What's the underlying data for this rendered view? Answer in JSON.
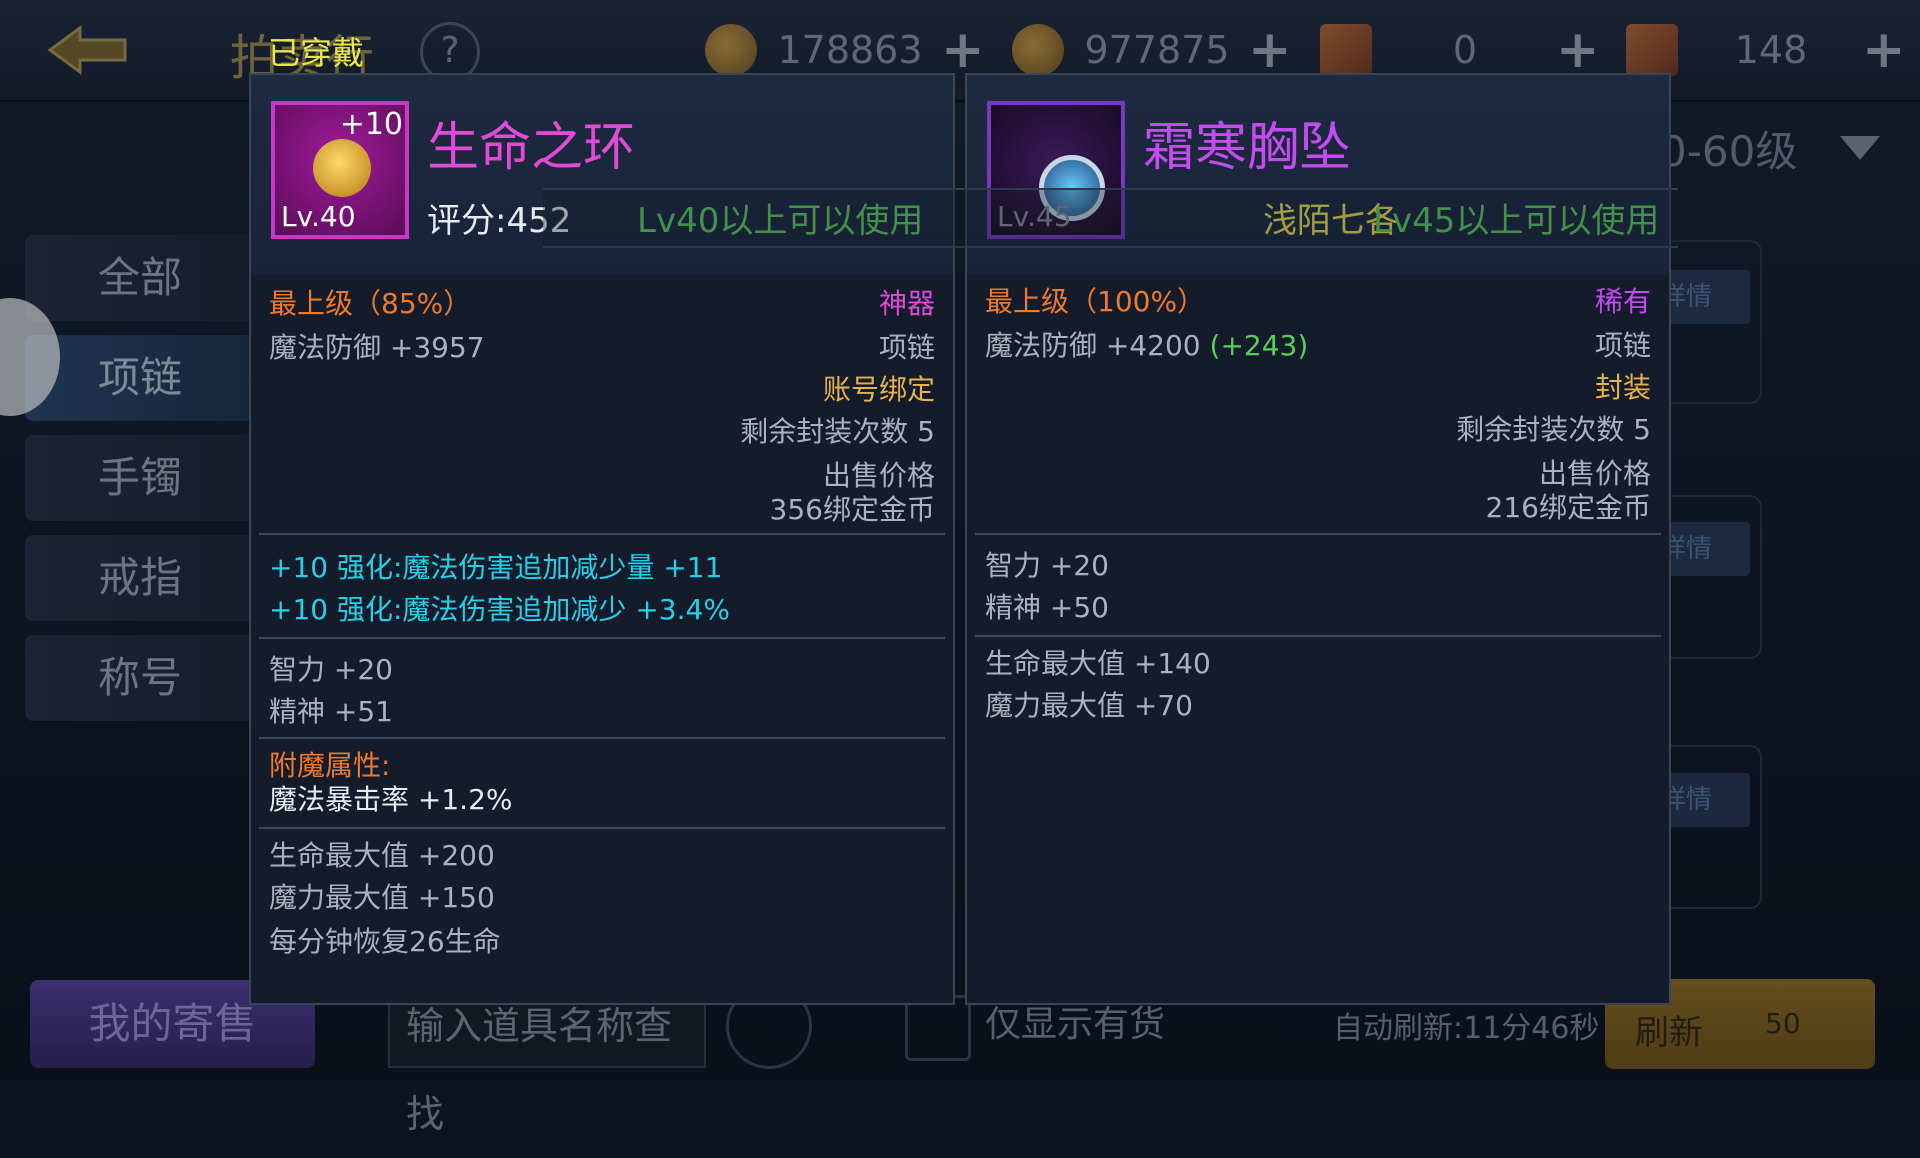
{
  "topbar": {
    "title": "拍卖行",
    "help": "?",
    "currencies": [
      {
        "icon": "gold-coin-icon",
        "value": "178863",
        "plus": "+"
      },
      {
        "icon": "bound-coin-icon",
        "value": "977875",
        "plus": "+"
      },
      {
        "icon": "scroll-icon",
        "value": "0",
        "plus": "+"
      },
      {
        "icon": "treasure-scroll-icon",
        "value": "148",
        "plus": "+"
      }
    ]
  },
  "sidebar": {
    "tabs": [
      "全部",
      "项链",
      "手镯",
      "戒指",
      "称号"
    ],
    "active": "项链"
  },
  "filter": {
    "level_range": "0-60级"
  },
  "list": {
    "detail_label": "详情"
  },
  "bottombar": {
    "my_sale": "我的寄售",
    "search_placeholder": "输入道具名称查找",
    "stock_only": "仅显示有货",
    "auto_refresh": "自动刷新:11分46秒",
    "refresh": "刷新",
    "refresh_cost": "50"
  },
  "equipped_tag": "已穿戴",
  "left_item": {
    "name": "生命之环",
    "enhance": "+10",
    "level": "Lv.40",
    "score": "评分:452",
    "requirement": "Lv40以上可以使用",
    "grade": "最上级（85%）",
    "rarity": "神器",
    "main_stat": "魔法防御 +3957",
    "type": "项链",
    "bind": "账号绑定",
    "seal_count": "剩余封装次数 5",
    "price_label": "出售价格",
    "price": "356绑定金币",
    "enhance_stats": [
      "+10 强化:魔法伤害追加减少量 +11",
      "+10 强化:魔法伤害追加减少 +3.4%"
    ],
    "stats": [
      "智力 +20",
      "精神 +51"
    ],
    "enchant_label": "附魔属性:",
    "enchant_value": "魔法暴击率 +1.2%",
    "extra_stats": [
      "生命最大值 +200",
      "魔力最大值 +150",
      "每分钟恢复26生命"
    ]
  },
  "right_item": {
    "name": "霜寒胸坠",
    "level": "Lv.45",
    "overlap_text": "浅陌七各",
    "requirement": "Lv45以上可以使用",
    "grade": "最上级（100%）",
    "rarity": "稀有",
    "main_stat": "魔法防御 +4200",
    "main_diff": "(+243)",
    "type": "项链",
    "bind": "封装",
    "seal_count": "剩余封装次数 5",
    "price_label": "出售价格",
    "price": "216绑定金币",
    "stats": [
      "智力 +20",
      "精神 +50"
    ],
    "extra_stats": [
      "生命最大值 +140",
      "魔力最大值 +70"
    ]
  },
  "colors": {
    "legendary_name": "#e24ad8",
    "rare_name": "#c44cf0",
    "grade": "#ef7a2a",
    "requirement": "#5cd05c",
    "enhance": "#24d1e8"
  }
}
